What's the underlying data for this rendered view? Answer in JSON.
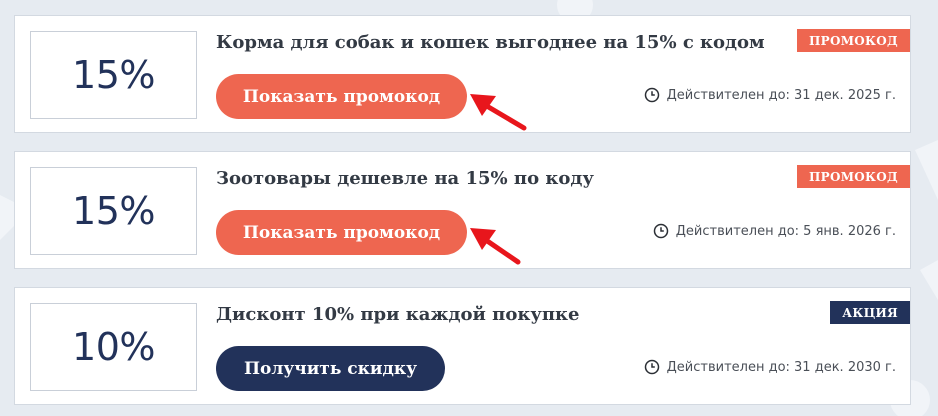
{
  "offers": [
    {
      "discount": "15%",
      "title": "Корма для собак и кошек выгоднее на 15% с кодом",
      "button_label": "Показать промокод",
      "badge": "ПРОМОКОД",
      "validity": "Действителен до: 31 дек. 2025 г.",
      "style": "orange"
    },
    {
      "discount": "15%",
      "title": "Зоотовары дешевле на 15% по коду",
      "button_label": "Показать промокод",
      "badge": "ПРОМОКОД",
      "validity": "Действителен до: 5 янв. 2026 г.",
      "style": "orange"
    },
    {
      "discount": "10%",
      "title": "Дисконт 10% при каждой покупке",
      "button_label": "Получить скидку",
      "badge": "АКЦИЯ",
      "validity": "Действителен до: 31 дек. 2030 г.",
      "style": "navy"
    }
  ],
  "colors": {
    "accent_orange": "#ee6650",
    "navy": "#22325a",
    "arrow_red": "#e8161c",
    "background": "#e6ebf1"
  },
  "icons": {
    "validity": "clock-icon",
    "annotation": "red-arrow-icon"
  }
}
